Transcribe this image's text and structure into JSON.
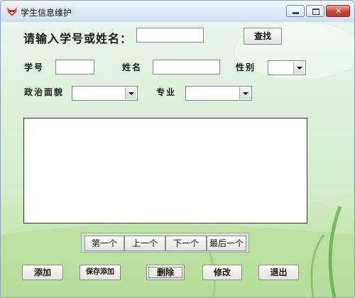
{
  "window": {
    "title": "学生信息维护",
    "close_glyph": "✕"
  },
  "search": {
    "label": "请输入学号或姓名：",
    "value": "",
    "button": "查找"
  },
  "fields": {
    "student_id_label": "学号",
    "student_id_value": "",
    "name_label": "姓名",
    "name_value": "",
    "gender_label": "性别",
    "gender_value": "",
    "political_label": "政治面貌",
    "political_value": "",
    "major_label": "专业",
    "major_value": ""
  },
  "navigation": {
    "first": "第一个",
    "prev": "上一个",
    "next": "下一个",
    "last": "最后一个"
  },
  "actions": {
    "add": "添加",
    "save_add": "保存添加",
    "delete": "删除",
    "modify": "修改",
    "exit": "退出"
  },
  "icons": {
    "app": "fox-icon",
    "minimize": "minimize-icon",
    "maximize": "maximize-icon",
    "close": "close-icon"
  }
}
